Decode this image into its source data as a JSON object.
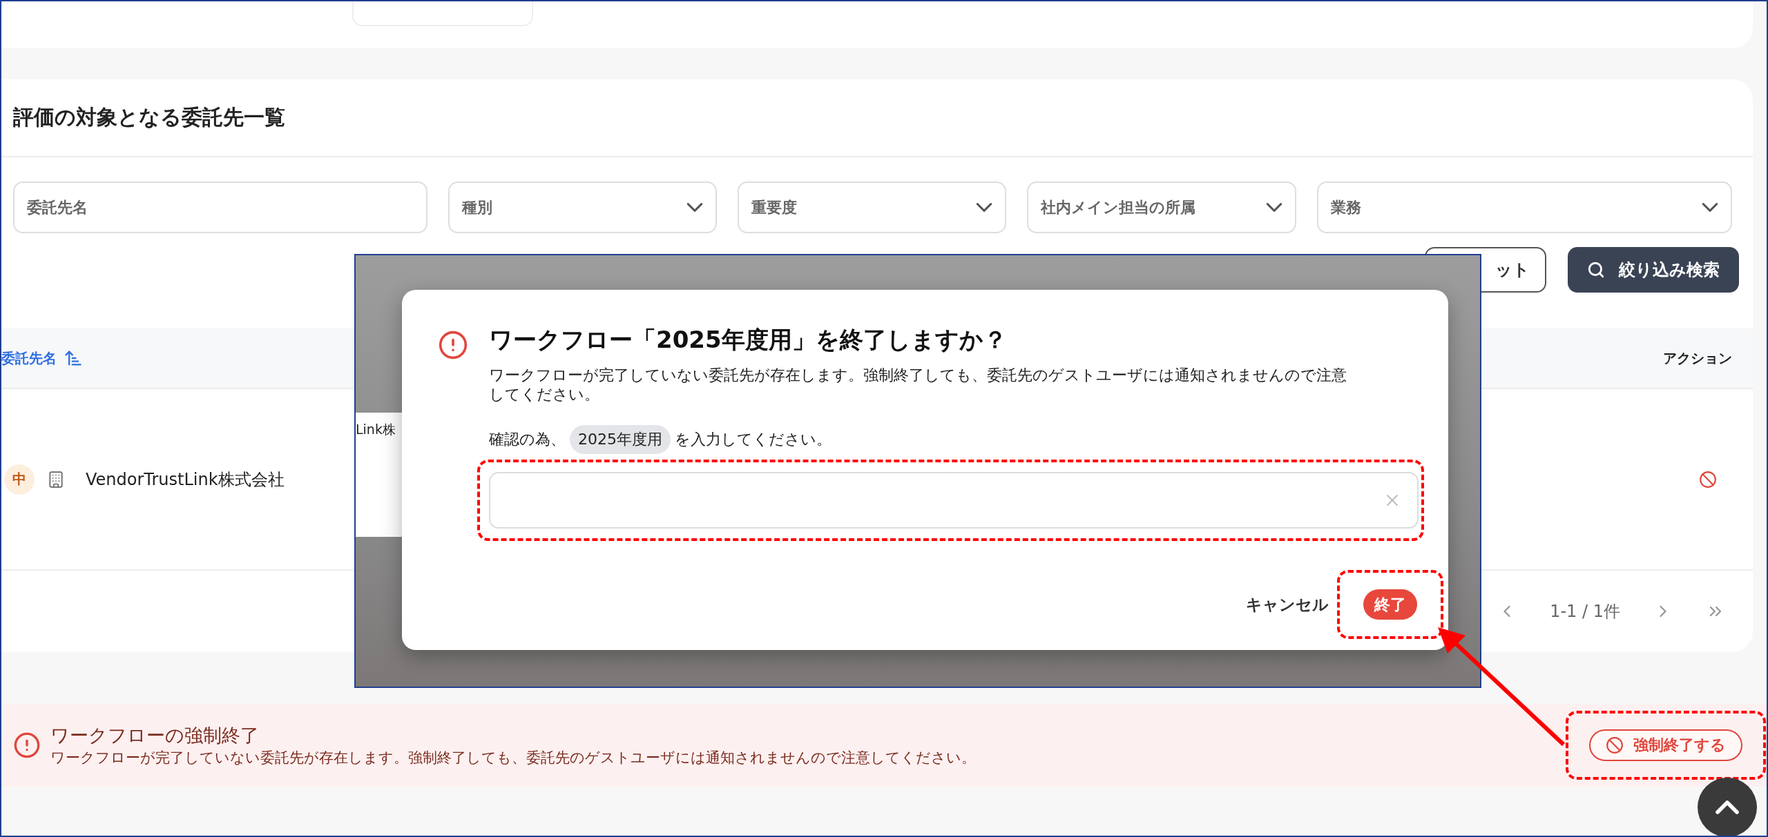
{
  "section": {
    "title": "評価の対象となる委託先一覧",
    "filters": [
      {
        "kind": "text",
        "placeholder": "委託先名"
      },
      {
        "kind": "select",
        "placeholder": "種別"
      },
      {
        "kind": "select",
        "placeholder": "重要度"
      },
      {
        "kind": "select",
        "placeholder": "社内メイン担当の所属"
      },
      {
        "kind": "select",
        "placeholder": "業務"
      }
    ],
    "actions": [
      {
        "kind": "outline",
        "label": "ット"
      },
      {
        "kind": "primary",
        "label": "絞り込み検索"
      }
    ],
    "table": {
      "columns": [
        {
          "label": "委託先名",
          "sorted": true
        },
        {
          "label": "アクション",
          "sorted": false
        }
      ],
      "rows": [
        {
          "priority": "中",
          "name": "VendorTrustLink株式会社",
          "column_2": "Link株"
        }
      ]
    },
    "pagination": {
      "range": "1-1 / 1件"
    }
  },
  "alert": {
    "title": "ワークフローの強制終了",
    "message": "ワークフローが完了していない委託先が存在します。強制終了しても、委託先のゲストユーザには通知されませんので注意してください。",
    "button": "強制終了する"
  },
  "dialog": {
    "title": "ワークフロー「2025年度用」を終了しますか？",
    "message": "ワークフローが完了していない委託先が存在します。強制終了しても、委託先のゲストユーザには通知されませんので注意してください。",
    "confirm_prefix": "確認の為、",
    "confirm_token": "2025年度用",
    "confirm_suffix": "を入力してください。",
    "cancel": "キャンセル",
    "submit": "終了"
  }
}
